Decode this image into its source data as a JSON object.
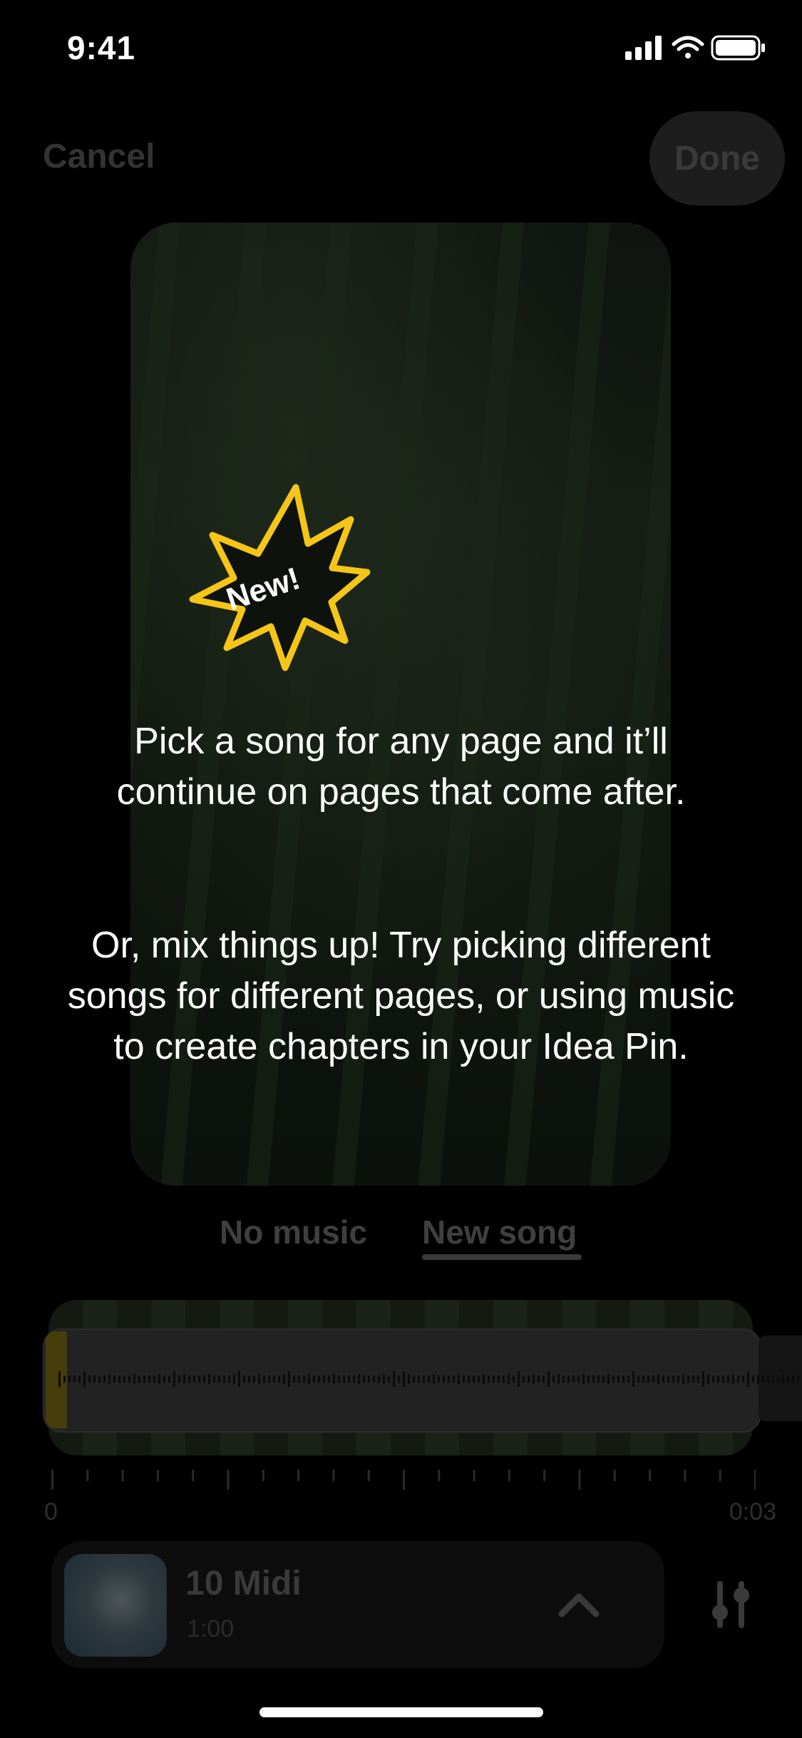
{
  "status_bar": {
    "time": "9:41"
  },
  "header": {
    "cancel_label": "Cancel",
    "done_label": "Done"
  },
  "badge": {
    "label": "New!"
  },
  "coach": {
    "paragraph_1": "Pick a song for any page and it’ll continue on pages that come after.",
    "paragraph_2": "Or, mix things up! Try picking different songs for different pages, or using music to create chapters in your Idea Pin."
  },
  "tabs": {
    "no_music": "No music",
    "new_song": "New song",
    "selected": "New song"
  },
  "timeline": {
    "start": "0",
    "end": "0:03"
  },
  "song": {
    "title": "10 Midi",
    "duration": "1:00"
  },
  "colors": {
    "badge_accent": "#f5c518",
    "background": "#000000"
  }
}
